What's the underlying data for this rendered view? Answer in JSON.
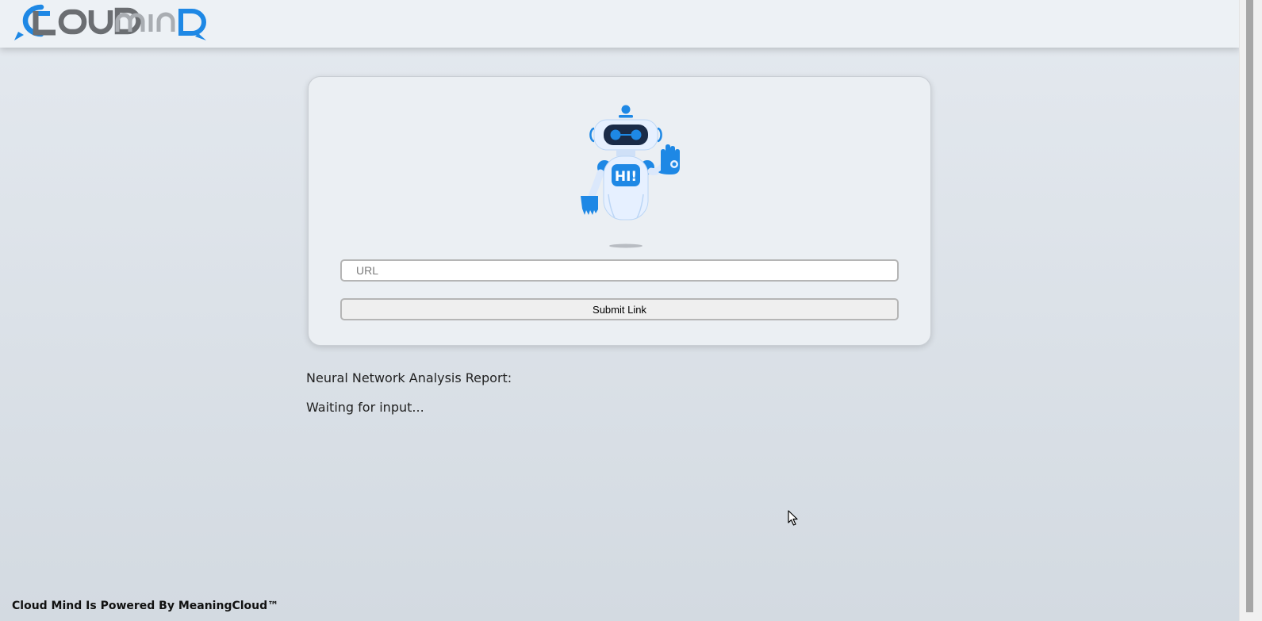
{
  "header": {
    "logo": {
      "text": "CLOUD MIND",
      "icon": "cloud-mind-logo",
      "colors": {
        "blue": "#1e88e5",
        "gray": "#6b6e72"
      }
    }
  },
  "form": {
    "robot_illustration": {
      "icon": "robot-waving-icon",
      "badge_text": "HI!"
    },
    "url_placeholder": "URL",
    "url_value": "",
    "submit_label": "Submit Link"
  },
  "report": {
    "title": "Neural Network Analysis Report:",
    "status": "Waiting for input..."
  },
  "footer": {
    "text": "Cloud Mind Is Powered By MeaningCloud™"
  },
  "colors": {
    "accent": "#1e88e5",
    "background": "#dde3e9",
    "card": "#ebeff3"
  }
}
